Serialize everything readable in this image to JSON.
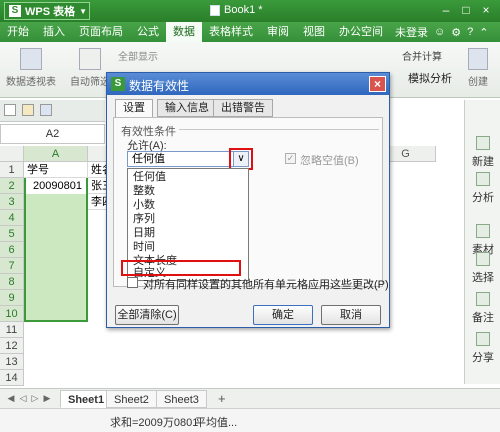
{
  "app": {
    "name": "WPS 表格",
    "logo": "S",
    "doc_title": "Book1 *"
  },
  "window_controls": {
    "minimize": "–",
    "restore": "□",
    "close": "×"
  },
  "menubar": {
    "items": [
      "开始",
      "插入",
      "页面布局",
      "公式",
      "数据",
      "表格样式",
      "审阅",
      "视图",
      "办公空间"
    ],
    "active": "数据",
    "login": "未登录"
  },
  "ribbon": {
    "pivot": "数据透视表",
    "autofilter": "自动筛选",
    "show_all": "全部显示",
    "merge_calc": "合并计算",
    "what_if": "模拟分析",
    "create": "创建"
  },
  "namebox": {
    "value": "A2"
  },
  "sheet": {
    "columns": [
      "A",
      "",
      "",
      "",
      "",
      "",
      "G"
    ],
    "rows": [
      "1",
      "2",
      "3",
      "4",
      "5",
      "6",
      "7",
      "8",
      "9",
      "10",
      "11",
      "12",
      "13",
      "14"
    ],
    "a1": "学号",
    "b1": "姓名",
    "a2": "20090801",
    "b2": "张三",
    "b3": "李四"
  },
  "right_panel": [
    "新建",
    "分析",
    "素材",
    "选择",
    "备注",
    "分享"
  ],
  "sheet_tabs": {
    "tabs": [
      "Sheet1",
      "Sheet2",
      "Sheet3"
    ],
    "active": "Sheet1",
    "add": "+"
  },
  "status": {
    "sum": "求和=2009万0801",
    "avg": "平均值..."
  },
  "dialog": {
    "title": "数据有效性",
    "logo": "S",
    "close": "×",
    "tabs": [
      "设置",
      "输入信息",
      "出错警告"
    ],
    "active_tab": "设置",
    "group_label": "有效性条件",
    "allow_label": "允许(A):",
    "allow_value": "任何值",
    "arrow": "∨",
    "ignore_blank": "忽略空值(B)",
    "options": [
      "任何值",
      "整数",
      "小数",
      "序列",
      "日期",
      "时间",
      "文本长度",
      "自定义"
    ],
    "highlighted_option": "自定义",
    "apply_all": "对所有同样设置的其他所有单元格应用这些更改(P)",
    "clear_all": "全部清除(C)",
    "ok": "确定",
    "cancel": "取消"
  },
  "colors": {
    "accent_green": "#3a9a3a",
    "dialog_blue": "#2f67bd",
    "highlight_red": "#e01010",
    "selection_fill": "#cce8c0"
  }
}
